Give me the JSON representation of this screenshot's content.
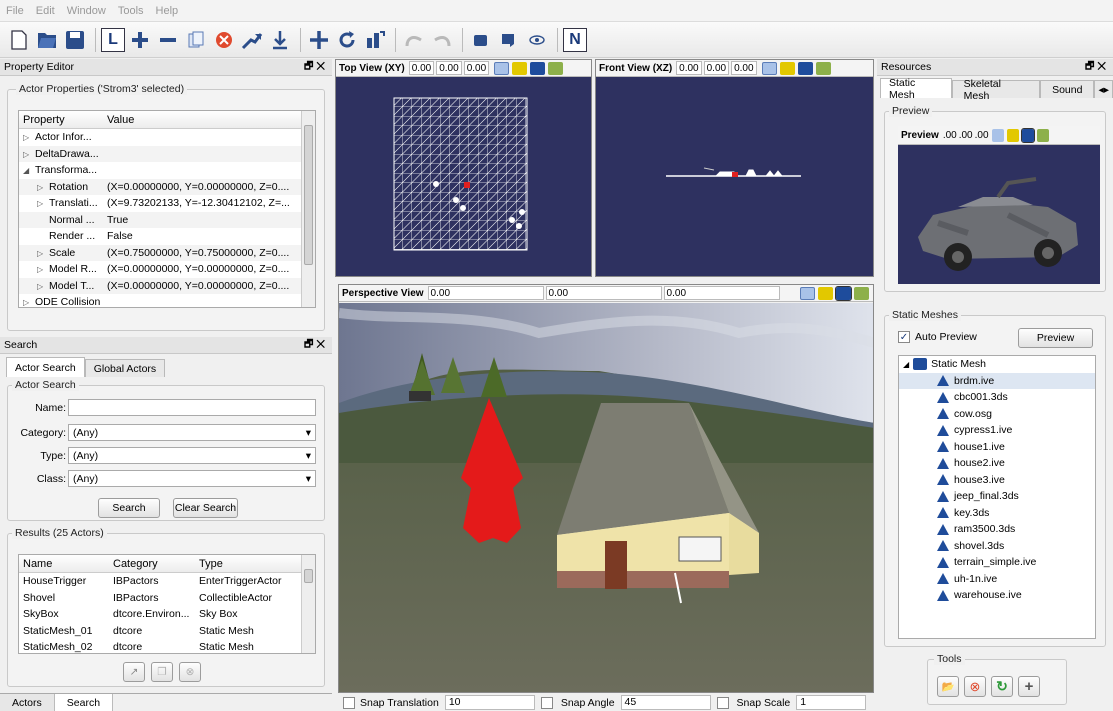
{
  "menu": [
    "File",
    "Edit",
    "Window",
    "Tools",
    "Help"
  ],
  "toolbar_icons": [
    "new-icon",
    "open-icon",
    "save-icon",
    "local-space-icon",
    "add-icon",
    "remove-icon",
    "copy-icon",
    "delete-icon",
    "goto-icon",
    "ground-clamp-icon",
    "translate-icon",
    "rotate-icon",
    "scale-icon",
    "undo-icon",
    "redo-icon",
    "camera-icon",
    "camera-alt-icon",
    "eye-icon",
    "snap-n-icon"
  ],
  "toolbar_n": "N",
  "property_editor": {
    "title": "Property Editor",
    "group": "Actor Properties ('Strom3' selected)",
    "col_property": "Property",
    "col_value": "Value",
    "rows": [
      {
        "arrow": "▷",
        "indent": 0,
        "name": "Actor Infor...",
        "value": ""
      },
      {
        "arrow": "▷",
        "indent": 0,
        "name": "DeltaDrawa...",
        "value": ""
      },
      {
        "arrow": "◢",
        "indent": 0,
        "name": "Transforma...",
        "value": ""
      },
      {
        "arrow": "▷",
        "indent": 1,
        "name": "Rotation",
        "value": "(X=0.00000000, Y=0.00000000, Z=0...."
      },
      {
        "arrow": "▷",
        "indent": 1,
        "name": "Translati...",
        "value": "(X=9.73202133, Y=-12.30412102, Z=..."
      },
      {
        "arrow": "",
        "indent": 1,
        "name": "Normal ...",
        "value": "True"
      },
      {
        "arrow": "",
        "indent": 1,
        "name": "Render ...",
        "value": "False"
      },
      {
        "arrow": "▷",
        "indent": 1,
        "name": "Scale",
        "value": "(X=0.75000000, Y=0.75000000, Z=0...."
      },
      {
        "arrow": "▷",
        "indent": 1,
        "name": "Model R...",
        "value": "(X=0.00000000, Y=0.00000000, Z=0...."
      },
      {
        "arrow": "▷",
        "indent": 1,
        "name": "Model T...",
        "value": "(X=0.00000000, Y=0.00000000, Z=0...."
      },
      {
        "arrow": "▷",
        "indent": 0,
        "name": "ODE Collision",
        "value": ""
      }
    ]
  },
  "search": {
    "title": "Search",
    "tabs": [
      "Actor Search",
      "Global Actors"
    ],
    "group": "Actor Search",
    "name_label": "Name:",
    "name_value": "",
    "category_label": "Category:",
    "category_value": "(Any)",
    "type_label": "Type:",
    "type_value": "(Any)",
    "class_label": "Class:",
    "class_value": "(Any)",
    "search_btn": "Search",
    "clear_btn": "Clear Search",
    "results_group": "Results (25 Actors)",
    "cols": [
      "Name",
      "Category",
      "Type"
    ],
    "results": [
      {
        "name": "HouseTrigger",
        "category": "IBPactors",
        "type": "EnterTriggerActor"
      },
      {
        "name": "Shovel",
        "category": "IBPactors",
        "type": "CollectibleActor"
      },
      {
        "name": "SkyBox",
        "category": "dtcore.Environ...",
        "type": "Sky Box"
      },
      {
        "name": "StaticMesh_01",
        "category": "dtcore",
        "type": "Static Mesh"
      },
      {
        "name": "StaticMesh_02",
        "category": "dtcore",
        "type": "Static Mesh"
      }
    ]
  },
  "bottom_tabs": [
    "Actors",
    "Search"
  ],
  "top_view": {
    "label": "Top View (XY)",
    "x": "0.00",
    "y": "0.00",
    "z": "0.00"
  },
  "front_view": {
    "label": "Front View (XZ)",
    "x": "0.00",
    "y": "0.00",
    "z": "0.00"
  },
  "perspective_view": {
    "label": "Perspective View",
    "x": "0.00",
    "y": "0.00",
    "z": "0.00"
  },
  "snap": {
    "translation_label": "Snap Translation",
    "translation_value": "10",
    "angle_label": "Snap Angle",
    "angle_value": "45",
    "scale_label": "Snap Scale",
    "scale_value": "1"
  },
  "resources": {
    "title": "Resources",
    "tabs": [
      "Static Mesh",
      "Skeletal Mesh",
      "Sound"
    ],
    "preview_group": "Preview",
    "preview_label": "Preview",
    "preview_x": ".00",
    "preview_y": ".00",
    "preview_z": ".00",
    "static_meshes_group": "Static Meshes",
    "auto_preview": "Auto Preview",
    "preview_btn": "Preview",
    "root": "Static Mesh",
    "items": [
      "brdm.ive",
      "cbc001.3ds",
      "cow.osg",
      "cypress1.ive",
      "house1.ive",
      "house2.ive",
      "house3.ive",
      "jeep_final.3ds",
      "key.3ds",
      "ram3500.3ds",
      "shovel.3ds",
      "terrain_simple.ive",
      "uh-1n.ive",
      "warehouse.ive"
    ],
    "selected": "brdm.ive",
    "tools_group": "Tools"
  },
  "colors": {
    "viewport_bg": "#2e3160",
    "accent": "#1f4c9a",
    "selection": "#dde6f2"
  }
}
